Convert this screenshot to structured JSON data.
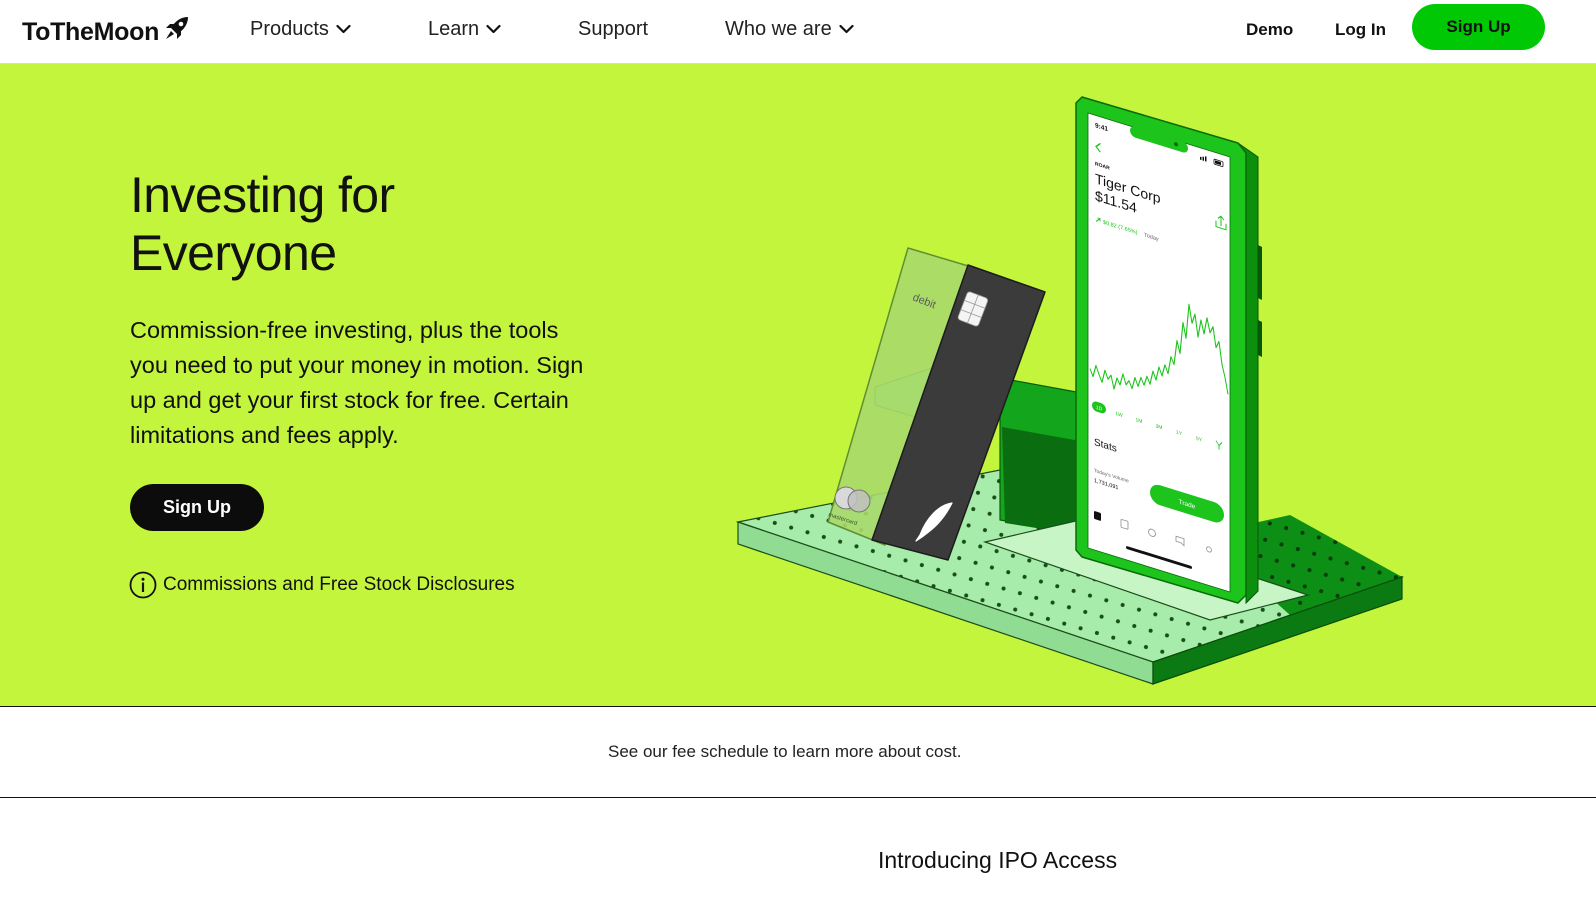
{
  "brand": {
    "name": "ToTheMoon",
    "icon": "rocket-icon"
  },
  "nav": {
    "items": [
      {
        "label": "Products",
        "has_dropdown": true
      },
      {
        "label": "Learn",
        "has_dropdown": true
      },
      {
        "label": "Support",
        "has_dropdown": false
      },
      {
        "label": "Who we are",
        "has_dropdown": true
      }
    ],
    "demo": "Demo",
    "login": "Log In",
    "signup": "Sign Up"
  },
  "hero": {
    "title_line1": "Investing for",
    "title_line2": "Everyone",
    "body": "Commission-free investing, plus the tools you need to put your money in motion. Sign up and get your first stock for free. Certain limitations and fees apply.",
    "cta": "Sign Up",
    "disclosure": "Commissions and Free Stock Disclosures",
    "disclosure_icon": "info-icon"
  },
  "illustration": {
    "phone": {
      "time": "9:41",
      "ticker": "ROAR",
      "company": "Tiger Corp",
      "price": "$11.54",
      "change": "$0.82 (7.65%)",
      "change_period": "Today",
      "ranges": [
        "1D",
        "1W",
        "1M",
        "3M",
        "1Y",
        "5Y"
      ],
      "selected_range": "1D",
      "stats_heading": "Stats",
      "volume_label": "Today's Volume",
      "volume_value": "1,731,091",
      "trade_button": "Trade"
    },
    "card": {
      "type_label": "debit",
      "network": "mastercard"
    }
  },
  "fee_band": {
    "text": "See our fee schedule to learn more about cost."
  },
  "ipo": {
    "title": "Introducing IPO Access"
  },
  "colors": {
    "hero_bg": "#c3f53c",
    "accent": "#00c805",
    "text": "#111111"
  }
}
